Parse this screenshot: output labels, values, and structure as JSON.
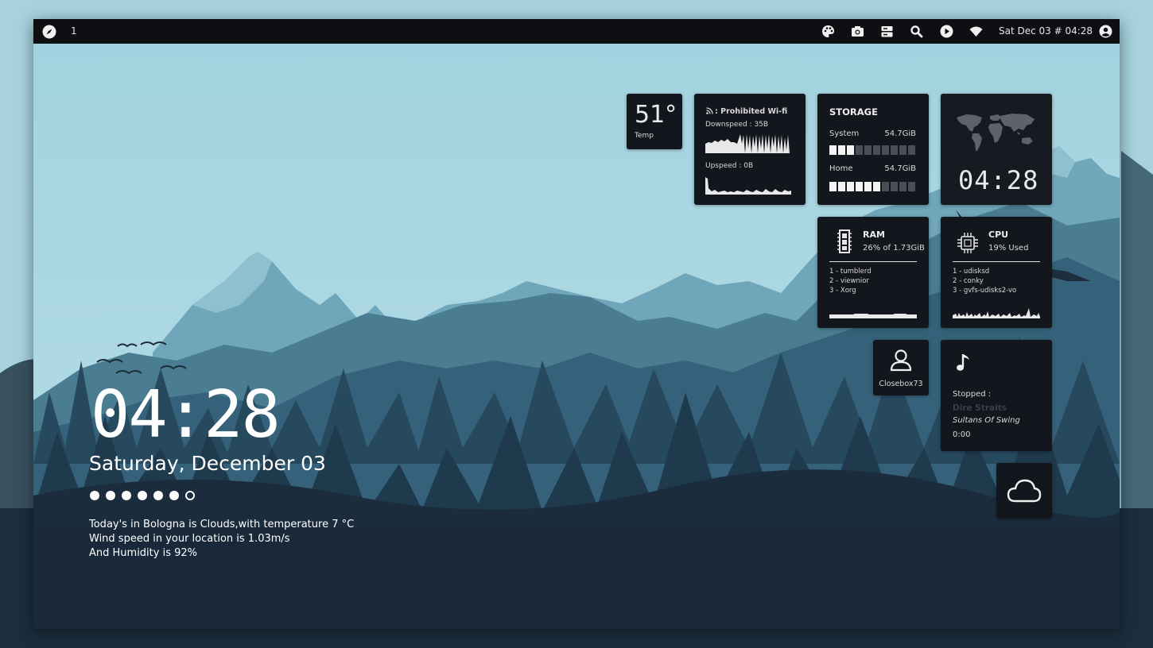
{
  "topbar": {
    "workspace": "1",
    "datetime": "Sat Dec 03 # 04:28"
  },
  "temp": {
    "value": "51°",
    "label": "Temp"
  },
  "network": {
    "ssid": ": Prohibited Wi-fi",
    "downspeed": "Downspeed : 35B",
    "upspeed": "Upspeed : 0B"
  },
  "storage": {
    "title": "STORAGE",
    "system_label": "System",
    "system_value": "54.7GiB",
    "system_fill": 0.3,
    "home_label": "Home",
    "home_value": "54.7GiB",
    "home_fill": 0.6
  },
  "worldclock": {
    "time": "04:28"
  },
  "ram": {
    "title": "RAM",
    "usage": "26% of 1.73GiB",
    "processes": [
      "1 - tumblerd",
      "2 - viewnior",
      "3 - Xorg"
    ]
  },
  "cpu": {
    "title": "CPU",
    "usage": "19% Used",
    "processes": [
      "1 - udisksd",
      "2 - conky",
      "3 - gvfs-udisks2-vo"
    ]
  },
  "user": {
    "name": "Closebox73"
  },
  "music": {
    "status": "Stopped :",
    "artist": "Dire Straits",
    "title": "Sultans Of Swing",
    "time": "0:00"
  },
  "desktop": {
    "clock": "04:28",
    "date": "Saturday, December 03",
    "weather_lines": [
      "Today's in Bologna is Clouds,with temperature 7 °C",
      "Wind speed in your location is 1.03m/s",
      "And Humidity is 92%"
    ],
    "dots_filled": 6,
    "dots_total": 7
  },
  "icons": {
    "workspace": "compass-icon",
    "tray": [
      "palette-icon",
      "camera-icon",
      "server-icon",
      "search-icon",
      "play-icon",
      "wifi-icon",
      "user-icon"
    ],
    "weather": "cloud-icon",
    "music": "music-note-icon",
    "user": "user-outline-icon",
    "ram": "memory-icon",
    "cpu": "chip-icon"
  },
  "colors": {
    "sky": "#a4d3e0",
    "tile": "#13161c",
    "topbar": "#0e0f13",
    "mountain_far": "#6aa3b6",
    "forest_dark": "#1a2d3c"
  }
}
